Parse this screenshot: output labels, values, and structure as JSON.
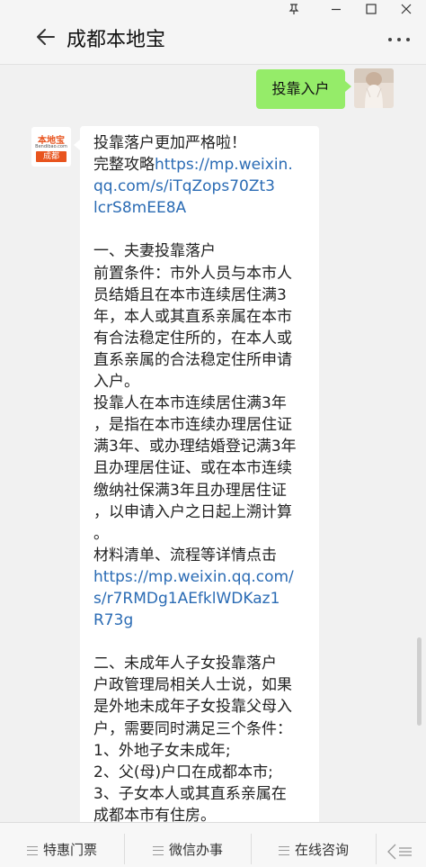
{
  "window": {
    "pin_icon": "pin-icon",
    "minimize_icon": "minimize-icon",
    "maximize_icon": "maximize-icon",
    "close_icon": "close-icon"
  },
  "header": {
    "title": "成都本地宝",
    "back_icon": "back-arrow-icon",
    "more_icon": "more-dots-icon"
  },
  "messages": {
    "outgoing": {
      "text": "投靠入户"
    },
    "incoming": {
      "sender_logo": {
        "top": "本地宝",
        "url": "Bendibao.com",
        "city": "成都"
      },
      "lines": [
        {
          "t": "投靠落户更加严格啦！"
        },
        {
          "t": "完整攻略",
          "link": "https://mp.weixin."
        },
        {
          "link": "qq.com/s/iTqZops70Zt3"
        },
        {
          "link": "lcrS8mEE8A"
        },
        {
          "t": ""
        },
        {
          "t": "一、夫妻投靠落户"
        },
        {
          "t": "前置条件：市外人员与本市人"
        },
        {
          "t": "员结婚且在本市连续居住满3"
        },
        {
          "t": "年，本人或其直系亲属在本市"
        },
        {
          "t": "有合法稳定住所的，在本人或"
        },
        {
          "t": "直系亲属的合法稳定住所申请"
        },
        {
          "t": "入户。"
        },
        {
          "t": "投靠人在本市连续居住满3年"
        },
        {
          "t": "，是指在本市连续办理居住证"
        },
        {
          "t": "满3年、或办理结婚登记满3年"
        },
        {
          "t": "且办理居住证、或在本市连续"
        },
        {
          "t": "缴纳社保满3年且办理居住证"
        },
        {
          "t": "，以申请入户之日起上溯计算"
        },
        {
          "t": "。"
        },
        {
          "t": "材料清单、流程等详情点击"
        },
        {
          "link": "https://mp.weixin.qq.com/"
        },
        {
          "link": "s/r7RMDg1AEfklWDKaz1"
        },
        {
          "link": "R73g"
        },
        {
          "t": ""
        },
        {
          "t": "二、未成年人子女投靠落户"
        },
        {
          "t": "户政管理局相关人士说，如果"
        },
        {
          "t": "是外地未成年子女投靠父母入"
        },
        {
          "t": "户，需要同时满足三个条件："
        },
        {
          "t": "1、外地子女未成年;"
        },
        {
          "t": "2、父(母)户口在成都本市;"
        },
        {
          "t": "3、子女本人或其直系亲属在"
        },
        {
          "t": "成都本市有住房。"
        }
      ]
    }
  },
  "menu": {
    "items": [
      "特惠门票",
      "微信办事",
      "在线咨询"
    ],
    "keyboard_icon": "keyboard-toggle-icon"
  },
  "colors": {
    "outgoing_bubble": "#95ec69",
    "link": "#2a6bb4",
    "logo_accent": "#e8541e"
  }
}
